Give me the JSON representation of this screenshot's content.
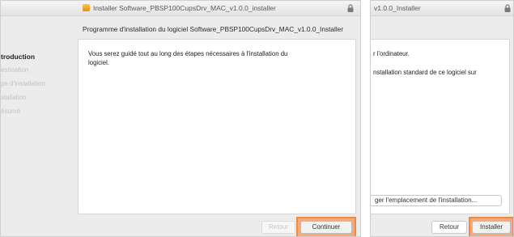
{
  "window_main": {
    "title": "Installer Software_PBSP100CupsDrv_MAC_v1.0.0_installer",
    "subheader": "Programme d'installation du logiciel Software_PBSP100CupsDrv_MAC_v1.0.0_Installer",
    "sidebar": [
      {
        "label": "troduction",
        "active": true
      },
      {
        "label": "estination",
        "active": false
      },
      {
        "label": "pe d'installation",
        "active": false
      },
      {
        "label": "stallation",
        "active": false
      },
      {
        "label": "ésumé",
        "active": false
      }
    ],
    "body_lines": [
      "Vous serez guidé tout au long des étapes nécessaires à l'installation du",
      "logiciel."
    ],
    "buttons": {
      "back": "Retour",
      "continue": "Continuer"
    }
  },
  "window_second": {
    "title": "v1.0.0_Installer",
    "body_lines": [
      "r l'ordinateur.",
      "nstallation standard de ce logiciel sur"
    ],
    "change_location": "ger l'emplacement de l'installation...",
    "buttons": {
      "back": "Retour",
      "install": "Installer"
    }
  },
  "colors": {
    "highlight": "#f08a3e",
    "title_icon": "#e58d1a"
  }
}
